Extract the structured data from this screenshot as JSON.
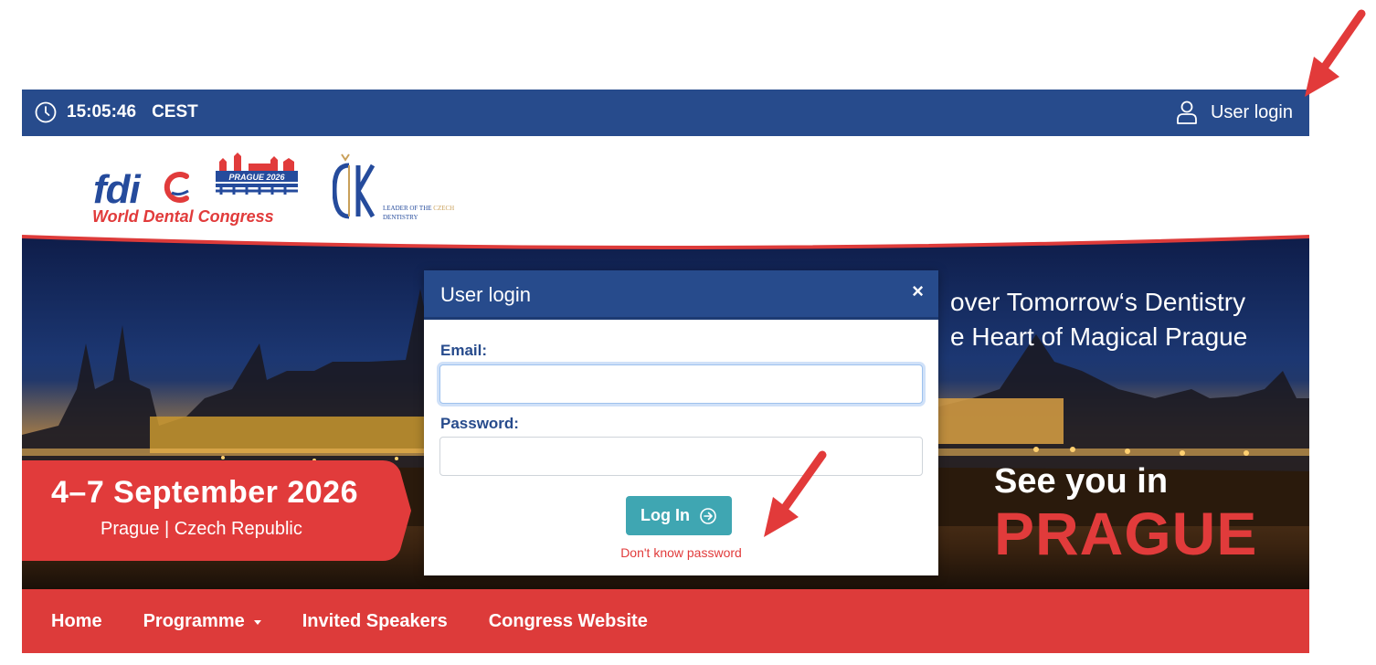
{
  "topbar": {
    "time": "15:05:46",
    "timezone": "CEST",
    "clock_icon": "clock-icon",
    "user_login_label": "User login",
    "user_icon": "user-icon"
  },
  "header": {
    "fdi_logo_text": "fdi",
    "fdi_subtitle": "World Dental Congress",
    "prague_logo_text": "PRAGUE 2026",
    "csk_text_line1": "LEADER OF THE",
    "csk_text_gold": "CZECH",
    "csk_text_line2": "DENTISTRY"
  },
  "hero": {
    "tagline": "over Tomorrow‘s Dentistry\ne Heart of Magical Prague",
    "date_main": "4–7 September 2026",
    "date_sub": "Prague | Czech Republic",
    "see_you": "See you in",
    "prague_big": "PRAGUE"
  },
  "nav": {
    "items": [
      {
        "label": "Home"
      },
      {
        "label": "Programme"
      },
      {
        "label": "Invited Speakers"
      },
      {
        "label": "Congress Website"
      }
    ]
  },
  "modal": {
    "title": "User login",
    "close": "×",
    "email_label": "Email:",
    "email_value": "",
    "password_label": "Password:",
    "password_value": "",
    "login_button": "Log In",
    "forgot_link": "Don't know password"
  },
  "colors": {
    "primary_blue": "#274b8c",
    "accent_red": "#dd3b3a",
    "button_teal": "#3fa6b2"
  }
}
